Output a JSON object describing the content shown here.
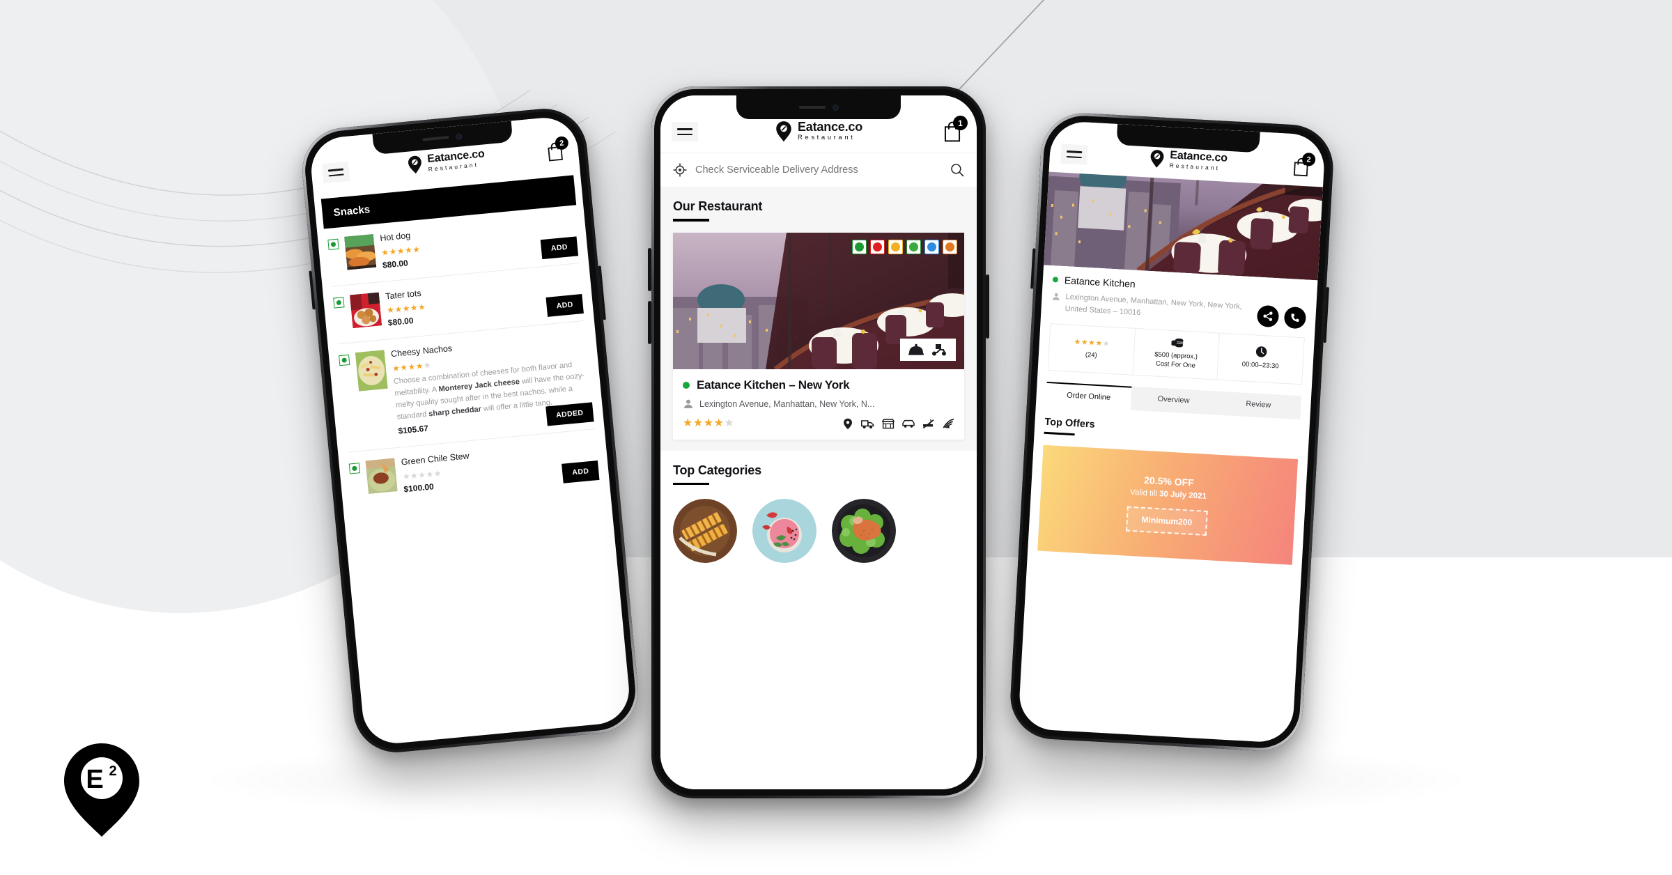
{
  "brand": {
    "logo_mark": "location-pin-E2",
    "logo_superscript": "2",
    "logo_letter": "E",
    "name_main": "Eatance.co",
    "name_sub": "Restaurant"
  },
  "colors": {
    "accent_black": "#000000",
    "star_gold": "#f5a623",
    "star_empty": "#d8d8d8",
    "veg_green": "#1a9a32",
    "open_green": "#17a83c",
    "offer_gradient_start": "#fbd97a",
    "offer_gradient_end": "#f5847c",
    "page_bg_top": "#e9eaec",
    "page_bg_bottom": "#ffffff"
  },
  "left_phone": {
    "header": {
      "menu_icon": "hamburger-icon",
      "cart_icon": "cart-icon",
      "cart_count": "2"
    },
    "section_title": "Snacks",
    "items": [
      {
        "name": "Hot dog",
        "rating": 5,
        "rating_max": 5,
        "price": "$80.00",
        "description": "",
        "button_label": "ADD",
        "diet": "veg",
        "thumb": "hotdog-photo"
      },
      {
        "name": "Tater tots",
        "rating": 5,
        "rating_max": 5,
        "price": "$80.00",
        "description": "",
        "button_label": "ADD",
        "diet": "veg",
        "thumb": "tatertots-photo"
      },
      {
        "name": "Cheesy Nachos",
        "rating": 4.5,
        "rating_max": 5,
        "price": "$105.67",
        "description_parts": [
          {
            "text": "Choose a combination of cheeses for both flavor and meltability. A ",
            "bold": false
          },
          {
            "text": "Monterey Jack cheese",
            "bold": true
          },
          {
            "text": " will have the oozy-melty quality sought after in the best nachos, while a standard ",
            "bold": false
          },
          {
            "text": "sharp cheddar",
            "bold": true
          },
          {
            "text": " will offer a little tang.",
            "bold": false
          }
        ],
        "button_label": "ADDED",
        "diet": "veg",
        "thumb": "nachos-photo"
      },
      {
        "name": "Green Chile Stew",
        "rating": 0,
        "rating_max": 5,
        "price": "$100.00",
        "description": "",
        "button_label": "ADD",
        "diet": "veg",
        "thumb": "stew-photo"
      }
    ]
  },
  "center_phone": {
    "header": {
      "menu_icon": "hamburger-icon",
      "cart_icon": "cart-icon",
      "cart_count": "1"
    },
    "address_bar": {
      "locate_icon": "crosshair-icon",
      "placeholder": "Check Serviceable Delivery Address",
      "value": "",
      "search_icon": "search-icon"
    },
    "our_restaurant": {
      "title": "Our Restaurant"
    },
    "restaurant_card": {
      "photo": "restaurant-interior-skyline-photo",
      "diet_badges": [
        {
          "name": "veg-badge",
          "border": "#1d9a34",
          "dot": "#1d9a34"
        },
        {
          "name": "nonveg-badge",
          "border": "#e02020",
          "dot": "#e02020"
        },
        {
          "name": "egg-badge",
          "border": "#f2b01e",
          "dot": "#f2b01e"
        },
        {
          "name": "vegan-badge",
          "border": "#1d9a34",
          "dot": "#3aa93f"
        },
        {
          "name": "gluten-free-badge",
          "border": "#2d8ce0",
          "dot": "#2d8ce0"
        },
        {
          "name": "halal-badge",
          "border": "#e07a20",
          "dot": "#e07a20"
        }
      ],
      "serve_badge": {
        "dine_in_icon": "cloche-icon",
        "delivery_icon": "scooter-icon"
      },
      "status": "open",
      "name": "Eatance Kitchen – New York",
      "address": "Lexington Avenue, Manhattan, New York, N...",
      "rating": 4.5,
      "rating_max": 5,
      "amenities": [
        "location-pin-icon",
        "delivery-truck-icon",
        "storefront-icon",
        "parking-car-icon",
        "no-smoking-icon",
        "wifi-icon"
      ]
    },
    "top_categories": {
      "title": "Top Categories",
      "items": [
        {
          "name": "sandwich-category",
          "image": "grilled-sandwich-photo"
        },
        {
          "name": "smoothie-category",
          "image": "strawberry-smoothie-photo"
        },
        {
          "name": "salad-category",
          "image": "chicken-salad-photo"
        }
      ]
    }
  },
  "right_phone": {
    "header": {
      "menu_icon": "hamburger-icon",
      "cart_icon": "cart-icon",
      "cart_count": "2"
    },
    "hero_photo": "restaurant-interior-skyline-photo",
    "restaurant": {
      "status": "open",
      "name": "Eatance Kitchen",
      "address": "Lexington Avenue, Manhattan, New York, New York, United States – 10016",
      "share_icon": "share-icon",
      "call_icon": "phone-icon"
    },
    "stats": [
      {
        "name": "rating-stat",
        "icon": "stars-icon",
        "rating": 4.5,
        "rating_max": 5,
        "label": "(24)"
      },
      {
        "name": "cost-stat",
        "icon": "coins-icon",
        "label": "$500 (approx.)\nCost For One"
      },
      {
        "name": "hours-stat",
        "icon": "clock-icon",
        "label": "00:00–23:30"
      }
    ],
    "stats_text": {
      "rating_count": "(24)",
      "cost_line1": "$500 (approx.)",
      "cost_line2": "Cost For One",
      "hours": "00:00–23:30"
    },
    "tabs": [
      {
        "label": "Order Online",
        "active": true
      },
      {
        "label": "Overview",
        "active": false
      },
      {
        "label": "Review",
        "active": false
      }
    ],
    "offers": {
      "title": "Top Offers",
      "card": {
        "percent": "20.5% OFF",
        "valid_prefix": "Valid till ",
        "valid_date": "30 July 2021",
        "code": "Minimum200"
      }
    }
  }
}
